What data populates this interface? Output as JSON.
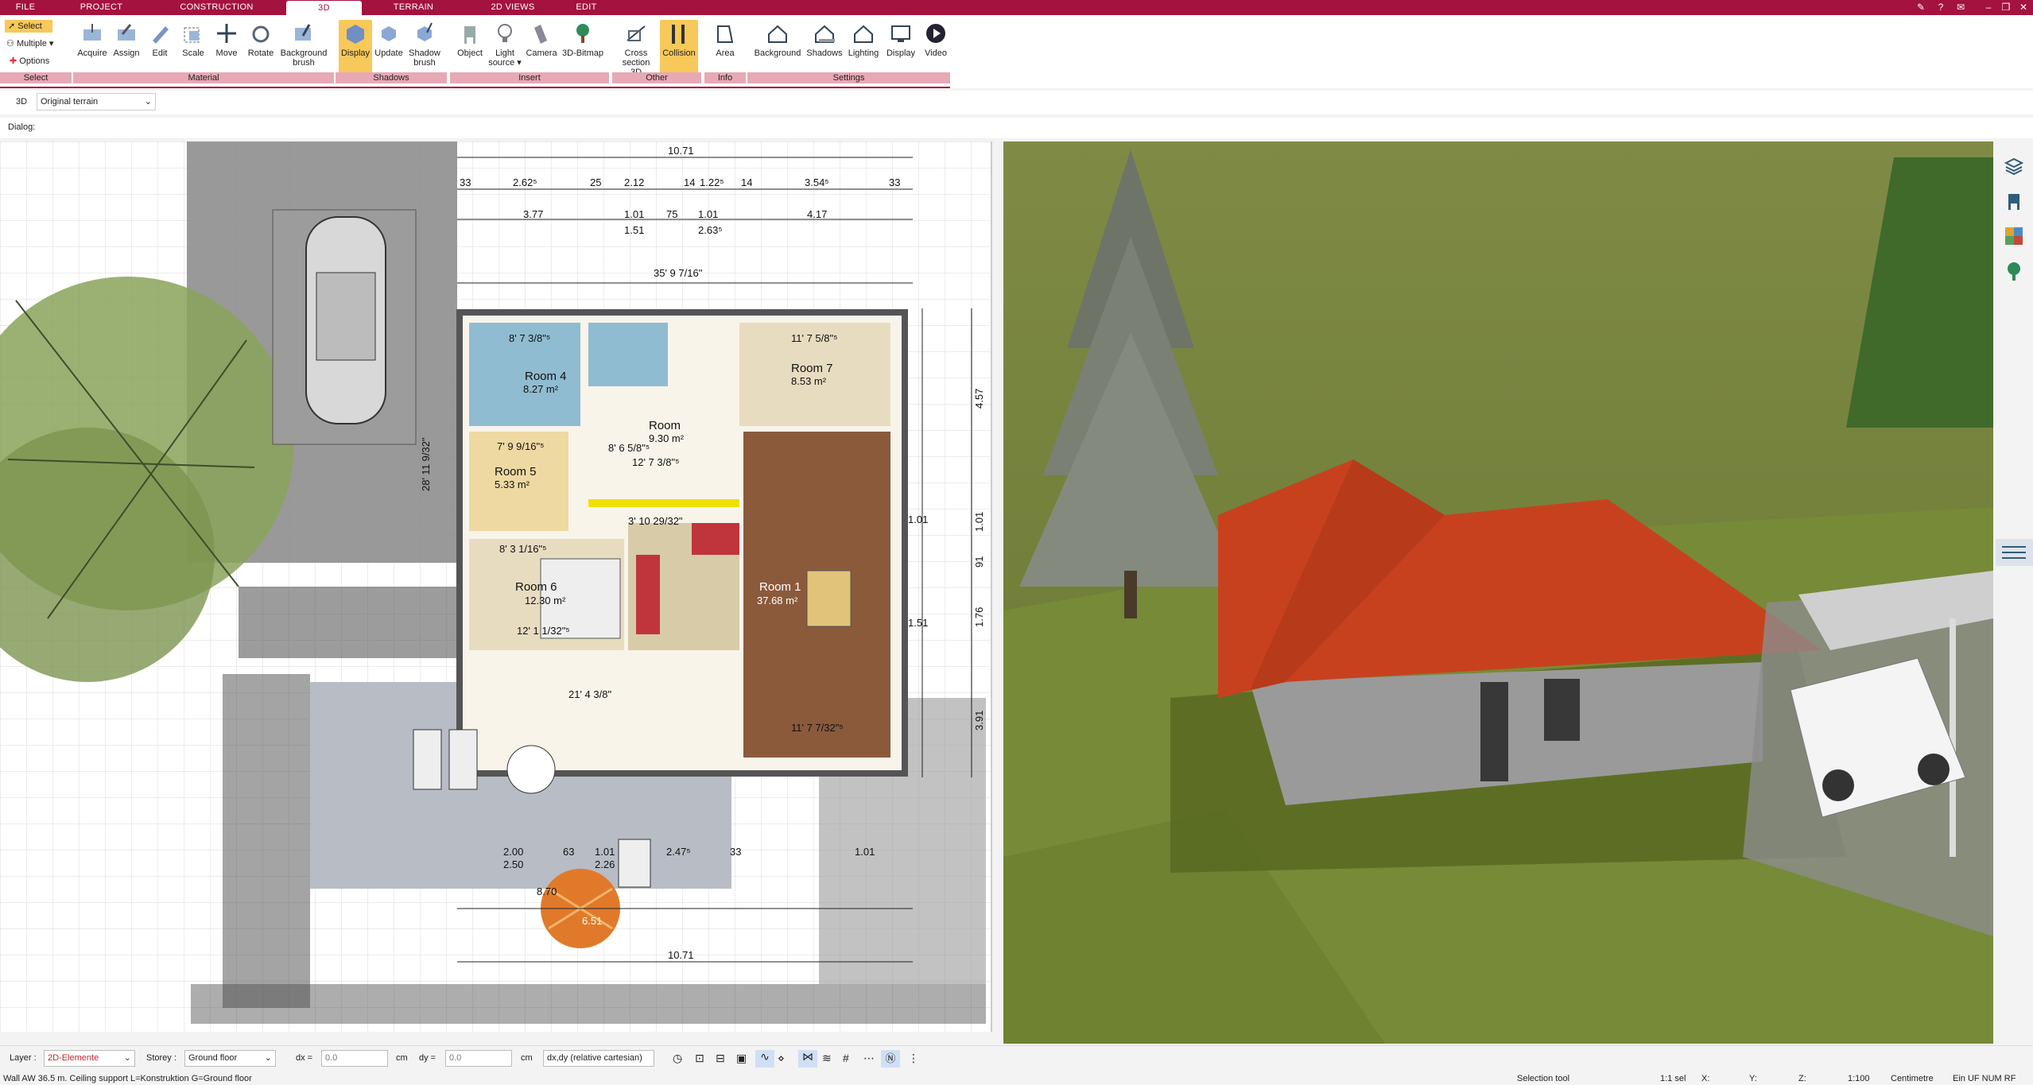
{
  "menu": {
    "tabs": [
      "FILE",
      "PROJECT",
      "CONSTRUCTION",
      "3D",
      "TERRAIN",
      "2D VIEWS",
      "EDIT"
    ],
    "active": "3D"
  },
  "ribbon": {
    "select": {
      "select_label": "Select",
      "multiple_label": "Multiple",
      "options_label": "Options",
      "group": "Select"
    },
    "material": {
      "group": "Material",
      "buttons": [
        "Acquire",
        "Assign",
        "Edit",
        "Scale",
        "Move",
        "Rotate",
        "Background brush"
      ]
    },
    "shadows": {
      "group": "Shadows",
      "buttons": [
        "Display",
        "Update",
        "Shadow brush"
      ]
    },
    "insert": {
      "group": "Insert",
      "buttons": [
        "Object",
        "Light source",
        "Camera",
        "3D-Bitmap"
      ]
    },
    "other": {
      "group": "Other",
      "buttons": [
        "Cross section 3D",
        "Collision"
      ]
    },
    "info": {
      "group": "Info",
      "buttons": [
        "Area"
      ]
    },
    "settings": {
      "group": "Settings",
      "buttons": [
        "Background",
        "Shadows",
        "Lighting",
        "Display",
        "Video"
      ]
    }
  },
  "viewrow": {
    "mode": "3D",
    "terrain": "Original terrain"
  },
  "dialogrow": {
    "label": "Dialog:"
  },
  "plan": {
    "rooms": [
      {
        "name": "Room 4",
        "area": "8.27 m²"
      },
      {
        "name": "Room 7",
        "area": "8.53 m²"
      },
      {
        "name": "Room 5",
        "area": "5.33 m²"
      },
      {
        "name": "Room 6",
        "area": "12.30 m²"
      },
      {
        "name": "Room 1",
        "area": "37.68 m²"
      },
      {
        "name": "Room",
        "area": "9.30 m²"
      }
    ],
    "dims_top": [
      "10.71",
      "33",
      "2.62⁵",
      "25",
      "2.12",
      "14",
      "1.22⁵",
      "14",
      "3.54⁵",
      "33",
      "3.77",
      "1.01",
      "75",
      "1.01",
      "4.17",
      "1.51",
      "2.63⁵"
    ],
    "dims_bottom": [
      "2.00",
      "2.50",
      "63",
      "1.01",
      "2.26",
      "2.47⁵",
      "33",
      "10.71",
      "1.01"
    ],
    "dims_right": [
      "4.57",
      "1.01",
      "91",
      "1.76",
      "3.91",
      "1.01",
      "1.51"
    ],
    "labels": [
      "11' 7 5/8\"⁵",
      "8' 7 3/8\"⁵",
      "7' 9 9/16\"⁵",
      "8' 6 5/8\"⁵",
      "12' 7 3/8\"⁵",
      "8' 3 1/16\"⁵",
      "12' 1 1/32\"⁵",
      "21' 4 3/8\"",
      "11' 7 7/32\"⁵",
      "28' 11 9/32\"",
      "35' 9 7/16\"",
      "3' 10 29/32\"",
      "6.51",
      "8.70"
    ]
  },
  "layerbar": {
    "layer_label": "Layer :",
    "layer_value": "2D-Elemente",
    "storey_label": "Storey :",
    "storey_value": "Ground floor",
    "dx_label": "dx =",
    "dx_value": "0.0",
    "dx_unit": "cm",
    "dy_label": "dy =",
    "dy_value": "0.0",
    "dy_unit": "cm",
    "coord_mode": "dx,dy (relative cartesian)"
  },
  "statusbar": {
    "message": "Wall AW 36.5 m. Ceiling support L=Konstruktion G=Ground floor",
    "tool": "Selection tool",
    "scale_sel": "1:1 sel",
    "x_label": "X:",
    "y_label": "Y:",
    "z_label": "Z:",
    "zoom": "1:100",
    "unit": "Centimetre",
    "flags": "Ein  UF NUM RF"
  },
  "colors": {
    "menubar": "#a4123f",
    "ribbon_group_label": "#e7a9b6",
    "active_button": "#f7c85a",
    "roof": "#c8411f",
    "grass": "#6e7a3a",
    "room_wood": "#8a5a3b"
  }
}
